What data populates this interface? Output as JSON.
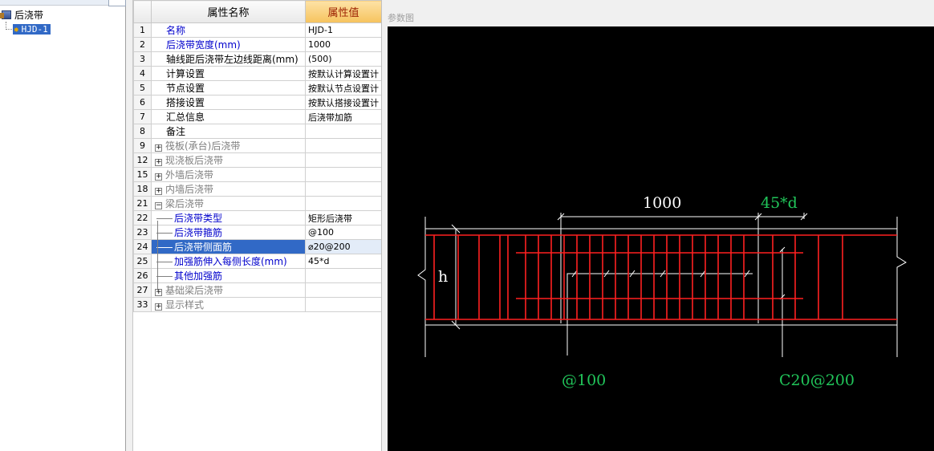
{
  "tree": {
    "root_label": "后浇带",
    "child_label": "HJD-1"
  },
  "grid": {
    "header_name": "属性名称",
    "header_value": "属性值",
    "rows": [
      {
        "num": "1",
        "name": "名称",
        "value": "HJD-1",
        "style": "blue",
        "level": 0
      },
      {
        "num": "2",
        "name": "后浇带宽度(mm)",
        "value": "1000",
        "style": "blue",
        "level": 0
      },
      {
        "num": "3",
        "name": "轴线距后浇带左边线距离(mm)",
        "value": "(500)",
        "style": "black",
        "level": 0
      },
      {
        "num": "4",
        "name": "计算设置",
        "value": "按默认计算设置计",
        "style": "black",
        "level": 0
      },
      {
        "num": "5",
        "name": "节点设置",
        "value": "按默认节点设置计",
        "style": "black",
        "level": 0
      },
      {
        "num": "6",
        "name": "搭接设置",
        "value": "按默认搭接设置计",
        "style": "black",
        "level": 0
      },
      {
        "num": "7",
        "name": "汇总信息",
        "value": "后浇带加筋",
        "style": "black",
        "level": 0
      },
      {
        "num": "8",
        "name": "备注",
        "value": "",
        "style": "black",
        "level": 0
      },
      {
        "num": "9",
        "name": "筏板(承台)后浇带",
        "value": "",
        "style": "gray",
        "level": 0,
        "expander": "+"
      },
      {
        "num": "12",
        "name": "现浇板后浇带",
        "value": "",
        "style": "gray",
        "level": 0,
        "expander": "+"
      },
      {
        "num": "15",
        "name": "外墙后浇带",
        "value": "",
        "style": "gray",
        "level": 0,
        "expander": "+"
      },
      {
        "num": "18",
        "name": "内墙后浇带",
        "value": "",
        "style": "gray",
        "level": 0,
        "expander": "+"
      },
      {
        "num": "21",
        "name": "梁后浇带",
        "value": "",
        "style": "gray",
        "level": 0,
        "expander": "−"
      },
      {
        "num": "22",
        "name": "后浇带类型",
        "value": "矩形后浇带",
        "style": "blue",
        "level": 1
      },
      {
        "num": "23",
        "name": "后浇带箍筋",
        "value": "@100",
        "style": "blue",
        "level": 1
      },
      {
        "num": "24",
        "name": "后浇带侧面筋",
        "value": "⌀20@200",
        "style": "blue",
        "level": 1,
        "selected": true
      },
      {
        "num": "25",
        "name": "加强筋伸入每侧长度(mm)",
        "value": "45*d",
        "style": "blue",
        "level": 1
      },
      {
        "num": "26",
        "name": "其他加强筋",
        "value": "",
        "style": "blue",
        "level": 1
      },
      {
        "num": "27",
        "name": "基础梁后浇带",
        "value": "",
        "style": "gray",
        "level": 0,
        "expander": "+"
      },
      {
        "num": "33",
        "name": "显示样式",
        "value": "",
        "style": "gray",
        "level": 0,
        "expander": "+"
      }
    ]
  },
  "diagram": {
    "title": "参数图",
    "labels": {
      "width": "1000",
      "anchor": "45*d",
      "height": "h",
      "stirrup": "@100",
      "side_bar": "C20@200"
    },
    "colors": {
      "background": "#000000",
      "rebar": "#ff2020",
      "dimension": "#ffffff",
      "annotation": "#21c55a"
    }
  }
}
